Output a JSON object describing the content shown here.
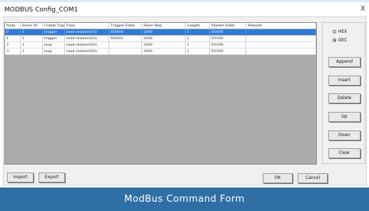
{
  "window": {
    "title": "MODBUS Config_COM1",
    "close_glyph": "X"
  },
  "table": {
    "headers": [
      "Num",
      "Slave ID",
      "Comm Type",
      "Func",
      "Trigger Elem",
      "Slave Reg",
      "Length",
      "Master Elem",
      "Remark"
    ],
    "rows": [
      [
        "0",
        "1",
        "trigger",
        "read resistor(03)",
        "M3000",
        "2000",
        "1",
        "D3000",
        ""
      ],
      [
        "1",
        "1",
        "trigger",
        "read resistor(03)",
        "M3001",
        "2000",
        "1",
        "D3100",
        ""
      ],
      [
        "2",
        "1",
        "loop",
        "read resistor(03)",
        "",
        "2000",
        "1",
        "D3200",
        ""
      ],
      [
        "3",
        "1",
        "loop",
        "read resistor(03)",
        "",
        "2000",
        "1",
        "D3300",
        ""
      ]
    ]
  },
  "format": {
    "hex_label": "HEX",
    "dec_label": "DEC",
    "selected": "DEC"
  },
  "side_buttons": {
    "append": "Append",
    "insert": "Insert",
    "delete": "Delete",
    "up": "Up",
    "down": "Down",
    "clear": "Clear"
  },
  "bottom_buttons": {
    "import": "Import",
    "export": "Export",
    "ok": "OK",
    "cancel": "Cancel"
  },
  "caption": "ModBus Command Form",
  "colors": {
    "selection": "#2f7bd6",
    "banner": "#2f6fa6",
    "grid_background": "#ababab"
  }
}
